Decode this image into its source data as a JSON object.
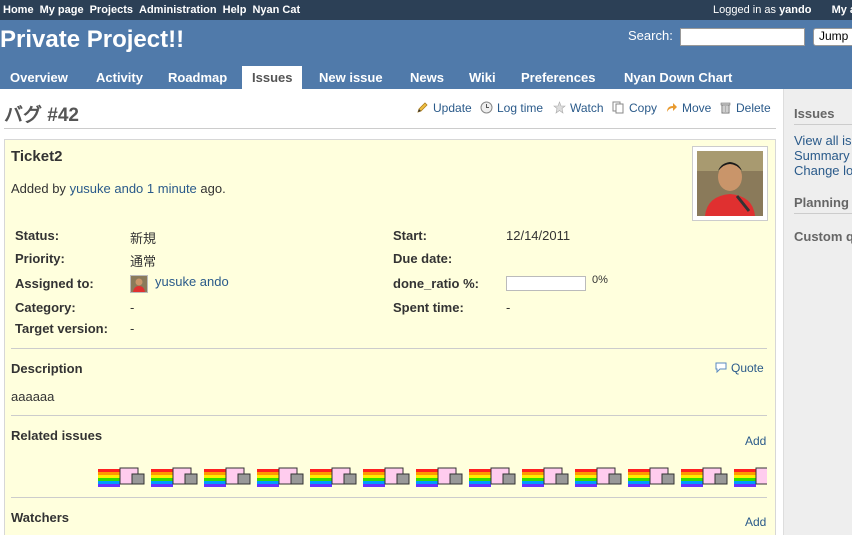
{
  "top_menu": {
    "items": [
      "Home",
      "My page",
      "Projects",
      "Administration",
      "Help",
      "Nyan Cat"
    ],
    "logged_in_prefix": "Logged in as",
    "logged_in_user": "yando",
    "my_account": "My a"
  },
  "header": {
    "title": "Private Project!!",
    "search_label": "Search:",
    "search_value": "",
    "jump_label": "Jump"
  },
  "main_menu": {
    "tabs": [
      "Overview",
      "Activity",
      "Roadmap",
      "Issues",
      "New issue",
      "News",
      "Wiki",
      "Preferences",
      "Nyan Down Chart"
    ],
    "selected": "Issues"
  },
  "issue": {
    "heading": "バグ #42",
    "actions": [
      "Update",
      "Log time",
      "Watch",
      "Copy",
      "Move",
      "Delete"
    ],
    "subject": "Ticket2",
    "added_by_prefix": "Added by",
    "author": "yusuke ando",
    "age": "1 minute",
    "ago": "ago.",
    "attributes": {
      "status_label": "Status:",
      "status": "新規",
      "priority_label": "Priority:",
      "priority": "通常",
      "assigned_label": "Assigned to:",
      "assigned": "yusuke ando",
      "category_label": "Category:",
      "category": "-",
      "target_label": "Target version:",
      "target": "-",
      "start_label": "Start:",
      "start": "12/14/2011",
      "due_label": "Due date:",
      "due": "",
      "done_label": "done_ratio %:",
      "done": "0%",
      "done_fraction": 0,
      "spent_label": "Spent time:",
      "spent": "-"
    },
    "description_title": "Description",
    "quote": "Quote",
    "description": "aaaaaa",
    "related_title": "Related issues",
    "related_add": "Add",
    "watchers_title": "Watchers",
    "watchers_add": "Add"
  },
  "sidebar": {
    "issues_title": "Issues",
    "links": [
      "View all is",
      "Summary",
      "Change lo"
    ],
    "planning_title": "Planning",
    "custom_title": "Custom q"
  }
}
